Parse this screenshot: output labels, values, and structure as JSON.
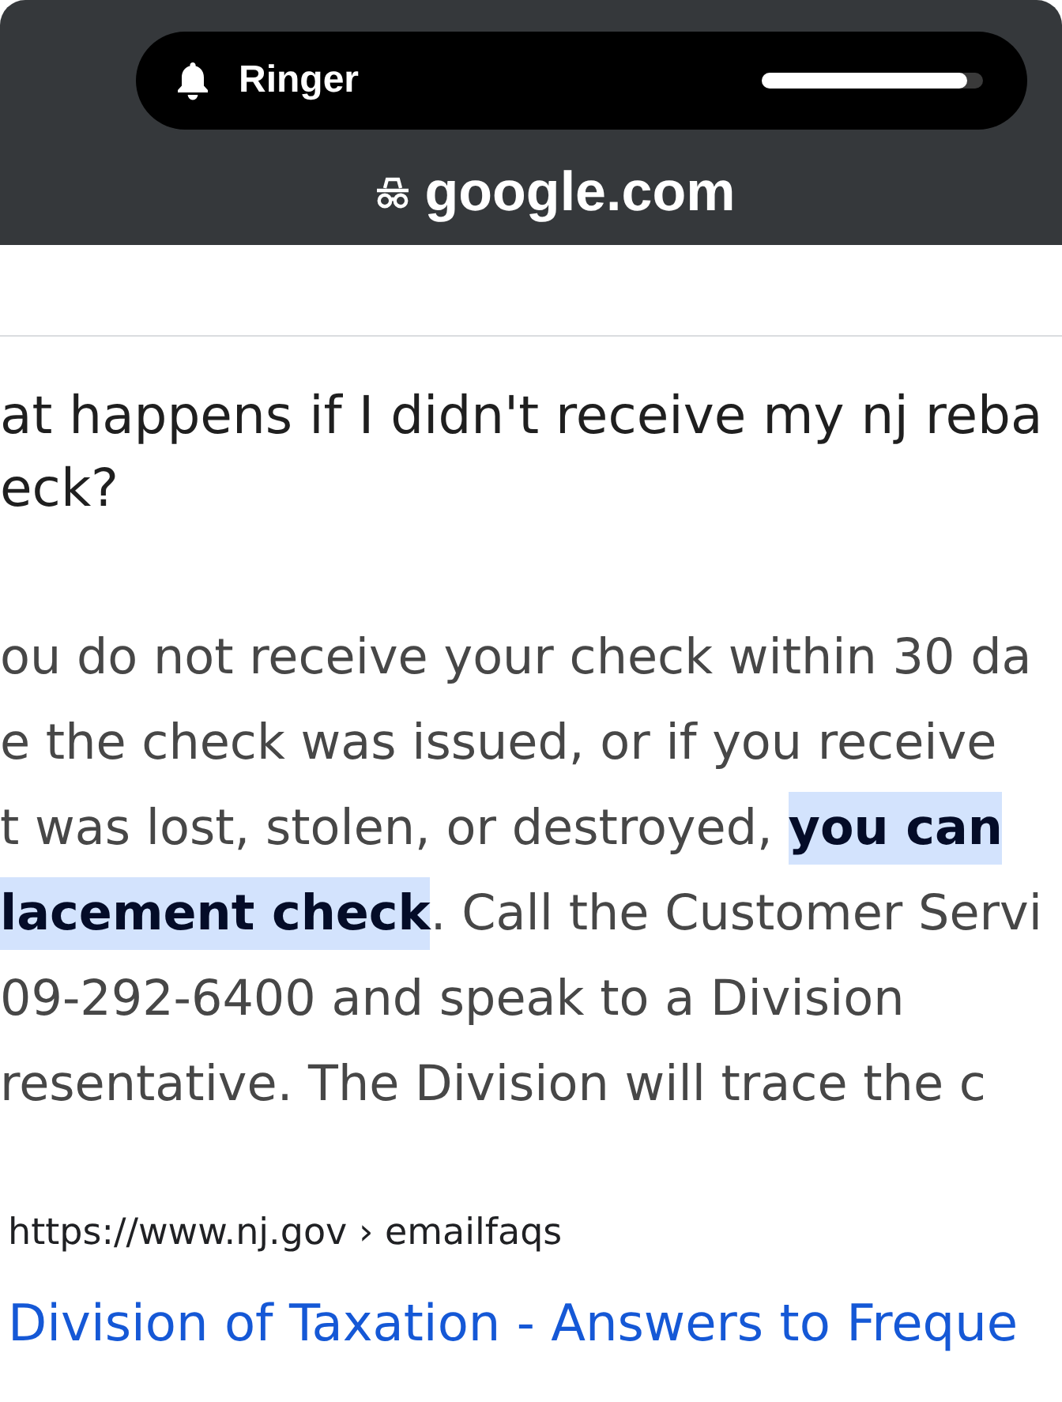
{
  "status_overlay": {
    "label": "Ringer",
    "level": 0.93
  },
  "address_bar": {
    "domain": "google.com"
  },
  "answer_card": {
    "question_lines": [
      "at happens if I didn't receive my nj reba",
      "eck?"
    ],
    "answer_lines": [
      "ou do not receive your check within 30 da",
      "e the check was issued, or if you receive",
      "t was lost, stolen, or destroyed, **you can**",
      "**lacement check**. Call the Customer Servi",
      "09-292-6400 and speak to a Division",
      "resentative. The Division will trace the c"
    ]
  },
  "source": {
    "url": "https://www.nj.gov › emailfaqs",
    "title": "Division of Taxation - Answers to Freque"
  }
}
